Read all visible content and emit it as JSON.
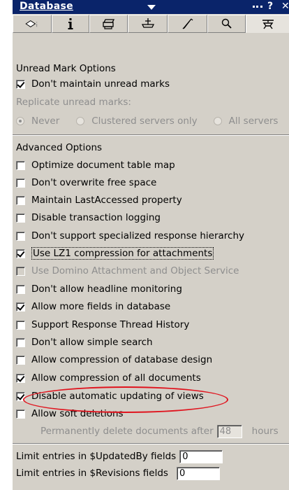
{
  "title_bar": {
    "title": "Database",
    "help": "?",
    "close": "✕"
  },
  "tabs": [
    {
      "icon": "disk-info-icon"
    },
    {
      "icon": "info-icon"
    },
    {
      "icon": "printer-icon"
    },
    {
      "icon": "archive-icon"
    },
    {
      "icon": "design-icon"
    },
    {
      "icon": "search-icon"
    },
    {
      "icon": "advanced-icon"
    }
  ],
  "unread": {
    "group_title": "Unread Mark Options",
    "dont_maintain": {
      "label": "Don't maintain unread marks",
      "checked": true
    },
    "replicate_label": "Replicate unread marks:",
    "radios": [
      "Never",
      "Clustered servers only",
      "All servers"
    ],
    "selected_radio": "Never"
  },
  "advanced": {
    "group_title": "Advanced Options",
    "options": [
      {
        "label": "Optimize document table map",
        "checked": false
      },
      {
        "label": "Don't overwrite free space",
        "checked": false
      },
      {
        "label": "Maintain LastAccessed property",
        "checked": false
      },
      {
        "label": "Disable transaction logging",
        "checked": false
      },
      {
        "label": "Don't support specialized response hierarchy",
        "checked": false
      },
      {
        "label": "Use LZ1 compression for attachments",
        "checked": true
      },
      {
        "label": "Use Domino Attachment and Object Service",
        "checked": false
      },
      {
        "label": "Don't allow headline monitoring",
        "checked": false
      },
      {
        "label": "Allow more fields in database",
        "checked": true
      },
      {
        "label": "Support Response Thread History",
        "checked": false
      },
      {
        "label": "Don't allow simple search",
        "checked": false
      },
      {
        "label": "Allow compression of database design",
        "checked": false
      },
      {
        "label": "Allow compression of all documents",
        "checked": true
      },
      {
        "label": "Disable automatic updating of views",
        "checked": true
      },
      {
        "label": "Allow soft deletions",
        "checked": false
      }
    ],
    "delete_prefix": "Permanently delete documents after",
    "delete_value": "48",
    "delete_suffix": "hours"
  },
  "limits": {
    "updated_by_label": "Limit entries in $UpdatedBy fields",
    "updated_by_value": "0",
    "revisions_label": "Limit entries in $Revisions fields",
    "revisions_value": "0"
  },
  "colors": {
    "title_bar": "#0a246a",
    "panel": "#d4d0c8",
    "highlight": "#e0141e"
  }
}
